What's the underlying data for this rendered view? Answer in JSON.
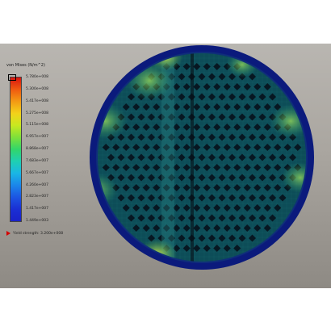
{
  "legend": {
    "title": "von Mises (N/m^2)",
    "max_marker_value": "5.780e+008",
    "labels": [
      "5.780e+008",
      "5.300e+008",
      "5.417e+008",
      "5.275e+008",
      "5.115e+008",
      "6.957e+007",
      "8.868e+007",
      "7.683e+007",
      "5.667e+007",
      "4.260e+007",
      "2.823e+007",
      "1.417e+007",
      "1.449e+003"
    ],
    "colors": [
      "#d8140f",
      "#ef5a10",
      "#f39a14",
      "#f3d21a",
      "#c8e820",
      "#7ee03a",
      "#32d66a",
      "#1fcfb2",
      "#1ab6e5",
      "#1b86ea",
      "#1c55e2",
      "#1a2fd4",
      "#1a22c8"
    ],
    "yield_text": "Yield strength: 3.200e+008"
  },
  "model": {
    "rim_color": "#0b1a7c",
    "mesh_color": "#0d4d58",
    "hole_color": "#07141f",
    "hotspot_colors": [
      "#3ca86a",
      "#8fd24a",
      "#c4e84a"
    ]
  }
}
